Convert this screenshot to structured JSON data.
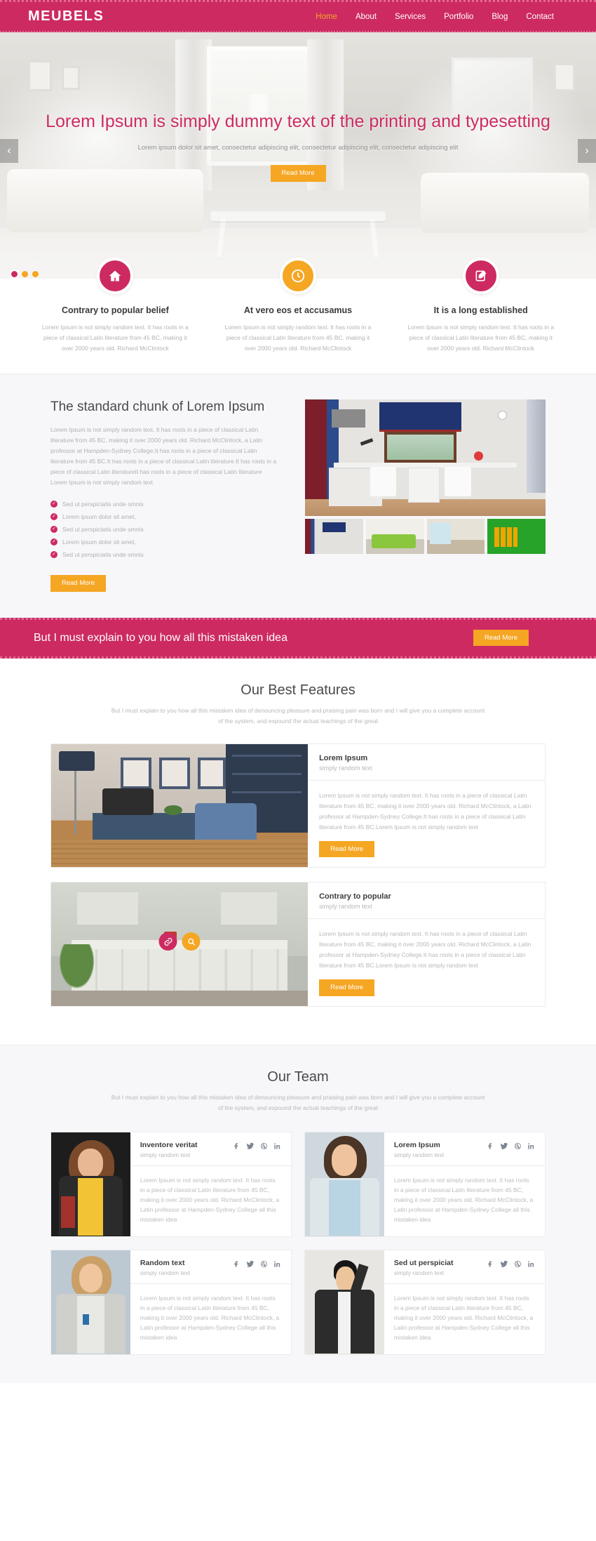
{
  "header": {
    "logo": "MEUBELS",
    "nav": [
      {
        "label": "Home",
        "active": true
      },
      {
        "label": "About",
        "active": false
      },
      {
        "label": "Services",
        "active": false
      },
      {
        "label": "Portfolio",
        "active": false
      },
      {
        "label": "Blog",
        "active": false
      },
      {
        "label": "Contact",
        "active": false
      }
    ]
  },
  "hero": {
    "title": "Lorem Ipsum is simply dummy text of the printing and typesetting",
    "subtitle": "Lorem ipsum dolor sit amet, consectetur adipiscing elit, consectetur adipiscing elit, consectetur adipiscing elit",
    "button": "Read More",
    "prev": "‹",
    "next": "›",
    "slides": 3,
    "active_slide": 1
  },
  "features3": [
    {
      "icon": "home-icon",
      "color": "#cd2a62",
      "title": "Contrary to popular belief",
      "text": "Lorem Ipsum is not simply random text. It has roots in a piece of classical Latin literature from 45 BC, making it over 2000 years old. Richard McClintock"
    },
    {
      "icon": "clock-icon",
      "color": "#f5a623",
      "title": "At vero eos et accusamus",
      "text": "Lorem Ipsum is not simply random text. It has roots in a piece of classical Latin literature from 45 BC, making it over 2000 years old. Richard McClintock"
    },
    {
      "icon": "edit-icon",
      "color": "#cd2a62",
      "title": "It is a long established",
      "text": "Lorem Ipsum is not simply random text. It has roots in a piece of classical Latin literature from 45 BC, making it over 2000 years old. Richard McClintock"
    }
  ],
  "chunk": {
    "heading": "The standard chunk of Lorem Ipsum",
    "paragraph": "Lorem Ipsum is not simply random text. It has roots in a piece of classical Latin literature from 45 BC, making it over 2000 years old. Richard McClintock, a Latin professor at Hampden-Sydney College.It has roots in a piece of classical Latin literature from 45 BC.It has roots in a piece of classical Latin literature.It has roots in a piece of classical Latin literatureIt has roots in a piece of classical Latin literature Lorem Ipsum is not simply random text",
    "list": [
      "Sed ut perspiciatis unde omnis",
      "Lorem ipsum dolor sit amet,",
      "Sed ut perspiciatis unde omnis",
      "Lorem ipsum dolor sit amet,",
      "Sed ut perspiciatis unde omnis"
    ],
    "button": "Read More"
  },
  "band": {
    "text": "But I must explain to you how all this mistaken idea",
    "button": "Read More"
  },
  "best_features": {
    "title": "Our Best Features",
    "subtitle": "But I must explain to you how all this mistaken idea of denouncing pleasure and praising pain was born and I will give you a complete account of the system, and expound the actual teachings of the great",
    "cards": [
      {
        "title": "Lorem Ipsum",
        "subtitle": "simply random text",
        "text": "Lorem Ipsum is not simply random text. It has roots in a piece of classical Latin literature from 45 BC, making it over 2000 years old. Richard McClintock, a Latin professor at Hampden-Sydney College.It has roots in a piece of classical Latin literature from 45 BC.Lorem Ipsum is not simply random text",
        "button": "Read More"
      },
      {
        "title": "Contrary to popular",
        "subtitle": "simply random text",
        "text": "Lorem Ipsum is not simply random text. It has roots in a piece of classical Latin literature from 45 BC, making it over 2000 years old. Richard McClintock, a Latin professor at Hampden-Sydney College.It has roots in a piece of classical Latin literature from 45 BC.Lorem Ipsum is not simply random text",
        "button": "Read More",
        "hover_icons": [
          "link-icon",
          "search-icon"
        ]
      }
    ]
  },
  "team": {
    "title": "Our Team",
    "subtitle": "But I must explain to you how all this mistaken idea of denouncing pleasure and praising pain was born and I will give you a complete account of the system, and expound the actual teachings of the great",
    "social": [
      "facebook-icon",
      "twitter-icon",
      "dribbble-icon",
      "linkedin-icon"
    ],
    "members": [
      {
        "name": "Inventore veritat",
        "role": "simply random text",
        "text": "Lorem Ipsum is not simply random text. It has roots in a piece of classical Latin literature from 45 BC, making it over 2000 years old. Richard McClintock, a Latin professor at Hampden-Sydney College all this mistaken idea"
      },
      {
        "name": "Lorem Ipsum",
        "role": "simply random text",
        "text": "Lorem Ipsum is not simply random text. It has roots in a piece of classical Latin literature from 45 BC, making it over 2000 years old. Richard McClintock, a Latin professor at Hampden-Sydney College all this mistaken idea"
      },
      {
        "name": "Random text",
        "role": "simply random text",
        "text": "Lorem Ipsum is not simply random text. It has roots in a piece of classical Latin literature from 45 BC, making it over 2000 years old. Richard McClintock, a Latin professor at Hampden-Sydney College all this mistaken idea"
      },
      {
        "name": "Sed ut perspiciat",
        "role": "simply random text",
        "text": "Lorem Ipsum is not simply random text. It has roots in a piece of classical Latin literature from 45 BC, making it over 2000 years old. Richard McClintock, a Latin professor at Hampden-Sydney College all this mistaken idea"
      }
    ]
  },
  "colors": {
    "brand_pink": "#cd2a62",
    "accent_orange": "#f5a623",
    "muted_text": "#b8b8bc"
  }
}
